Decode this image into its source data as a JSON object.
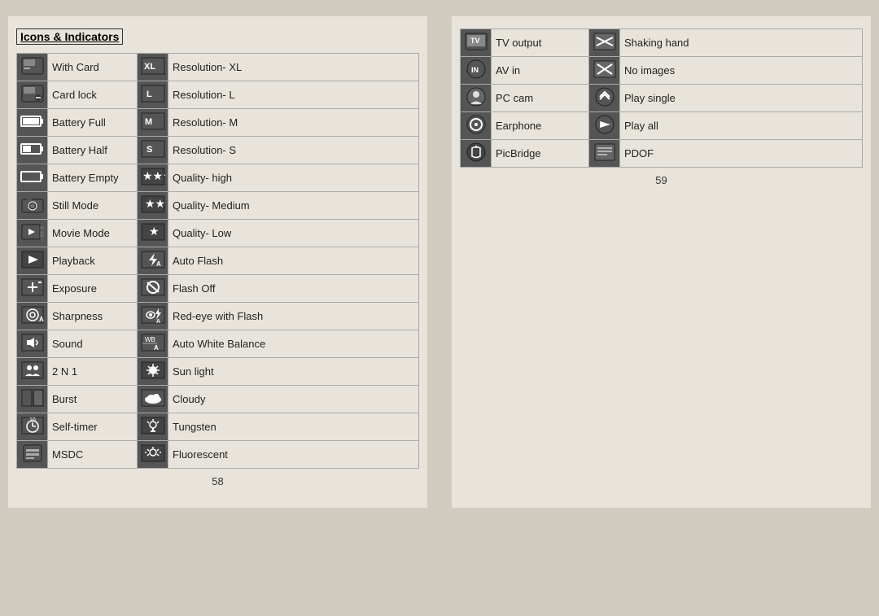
{
  "left_page": {
    "title": "Icons & Indicators",
    "page_num": "58",
    "rows_col1": [
      {
        "label": "With Card",
        "icon_text": "🃏"
      },
      {
        "label": "Card lock",
        "icon_text": "🔒"
      },
      {
        "label": "Battery Full",
        "icon_text": "▓▓▓"
      },
      {
        "label": "Battery Half",
        "icon_text": "▓▓░"
      },
      {
        "label": "Battery Empty",
        "icon_text": "░░░"
      },
      {
        "label": "Still Mode",
        "icon_text": "📷"
      },
      {
        "label": "Movie Mode",
        "icon_text": "🎞"
      },
      {
        "label": "Playback",
        "icon_text": "▶"
      },
      {
        "label": "Exposure",
        "icon_text": "±"
      },
      {
        "label": "Sharpness",
        "icon_text": "◎"
      },
      {
        "label": "Sound",
        "icon_text": "🔊"
      },
      {
        "label": "2 N 1",
        "icon_text": "👥"
      },
      {
        "label": "Burst",
        "icon_text": "⬛"
      },
      {
        "label": "Self-timer",
        "icon_text": "⏱"
      },
      {
        "label": "MSDC",
        "icon_text": "💾"
      }
    ],
    "rows_col2": [
      {
        "label": "Resolution- XL",
        "icon_text": "XL"
      },
      {
        "label": "Resolution- L",
        "icon_text": "L"
      },
      {
        "label": "Resolution- M",
        "icon_text": "M"
      },
      {
        "label": "Resolution- S",
        "icon_text": "S"
      },
      {
        "label": "Quality- high",
        "icon_text": "★★★"
      },
      {
        "label": "Quality- Medium",
        "icon_text": "★★"
      },
      {
        "label": "Quality- Low",
        "icon_text": "★"
      },
      {
        "label": "Auto Flash",
        "icon_text": "⚡A"
      },
      {
        "label": "Flash Off",
        "icon_text": "⊘"
      },
      {
        "label": "Red-eye with Flash",
        "icon_text": "👁A"
      },
      {
        "label": "Auto White Balance",
        "icon_text": "WB"
      },
      {
        "label": "Sun light",
        "icon_text": "☀"
      },
      {
        "label": "Cloudy",
        "icon_text": "☁"
      },
      {
        "label": "Tungsten",
        "icon_text": "💡"
      },
      {
        "label": "Fluorescent",
        "icon_text": "⚙"
      }
    ]
  },
  "right_page": {
    "page_num": "59",
    "rows": [
      {
        "icon1": "📺",
        "label1": "TV output",
        "icon2": "🤝",
        "label2": "Shaking hand"
      },
      {
        "icon1": "IN",
        "label1": "AV in",
        "icon2": "🚫",
        "label2": "No images"
      },
      {
        "icon1": "👤",
        "label1": "PC cam",
        "icon2": "🔄",
        "label2": "Play single"
      },
      {
        "icon1": "🎧",
        "label1": "Earphone",
        "icon2": "▶▶",
        "label2": "Play all"
      },
      {
        "icon1": "🔗",
        "label1": "PicBridge",
        "icon2": "📄",
        "label2": "PDOF"
      }
    ]
  }
}
